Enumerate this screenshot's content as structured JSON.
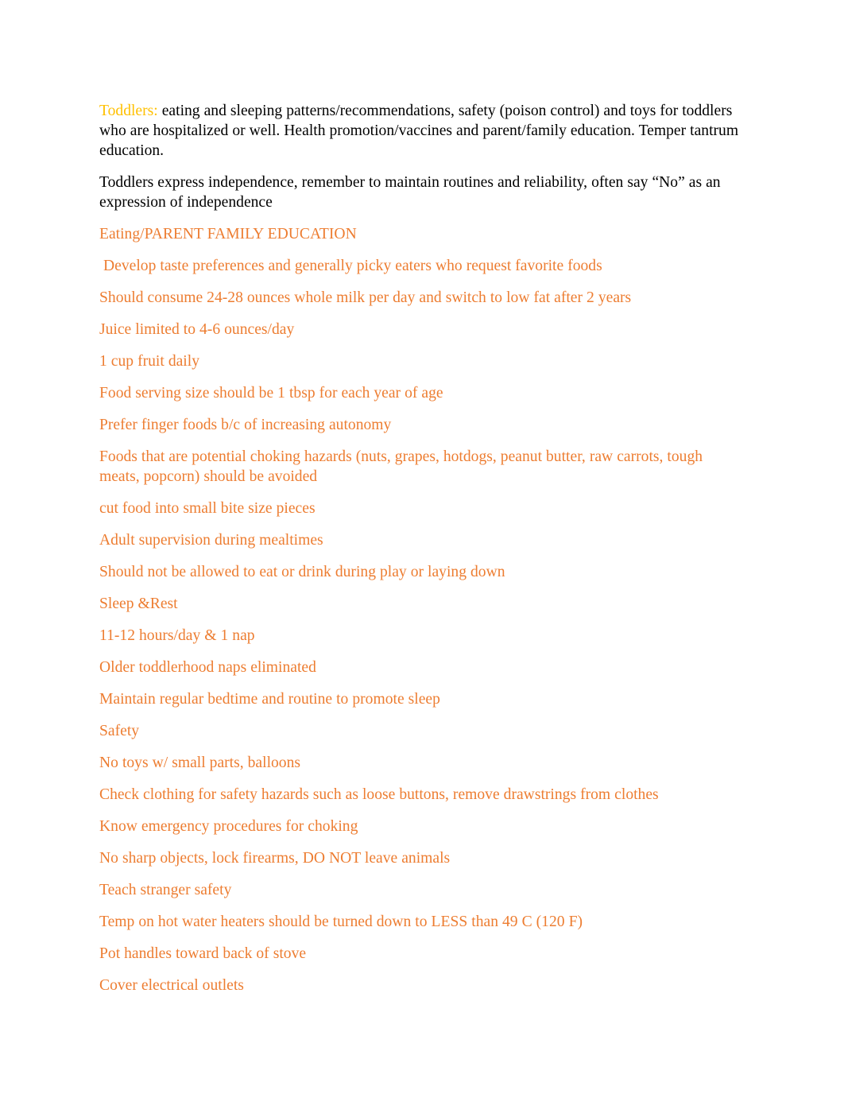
{
  "document": {
    "colors": {
      "label_gold": "#ffc000",
      "body_orange": "#ed7d31",
      "body_black": "#000000",
      "page_background": "#ffffff"
    },
    "intro": {
      "label": "Toddlers:",
      "text": " eating and sleeping patterns/recommendations, safety (poison control) and toys for toddlers who are hospitalized or well. Health promotion/vaccines and parent/family education. Temper tantrum education."
    },
    "independence_paragraph": "Toddlers express independence, remember to maintain routines and reliability, often say “No” as an expression of independence",
    "sections": [
      {
        "heading": "Eating/PARENT FAMILY EDUCATION",
        "lines": [
          " Develop taste preferences and generally picky eaters who request favorite foods",
          "Should consume 24-28 ounces whole milk per day and switch to low fat after 2 years",
          "Juice limited to 4-6 ounces/day",
          "1 cup fruit daily",
          "Food serving size should be 1 tbsp for each year of age",
          "Prefer finger foods b/c of increasing autonomy",
          "Foods that are potential choking hazards (nuts, grapes, hotdogs, peanut butter, raw carrots, tough meats, popcorn) should be avoided",
          "cut food into small bite size pieces",
          "Adult supervision during mealtimes",
          "Should not be allowed to eat or drink during play or laying down"
        ]
      },
      {
        "heading": "Sleep &Rest",
        "lines": [
          "11-12 hours/day & 1 nap",
          "Older toddlerhood naps eliminated",
          "Maintain regular bedtime and routine to promote sleep"
        ]
      },
      {
        "heading": "Safety",
        "lines": [
          "No toys w/ small parts, balloons",
          "Check clothing for safety hazards such as loose buttons, remove drawstrings from clothes",
          "Know emergency procedures for choking",
          "No sharp objects, lock firearms, DO NOT leave animals",
          "Teach stranger safety",
          "Temp on hot water heaters should be turned down to LESS than 49 C (120 F)",
          "Pot handles toward back of stove",
          "Cover electrical outlets"
        ]
      }
    ]
  }
}
